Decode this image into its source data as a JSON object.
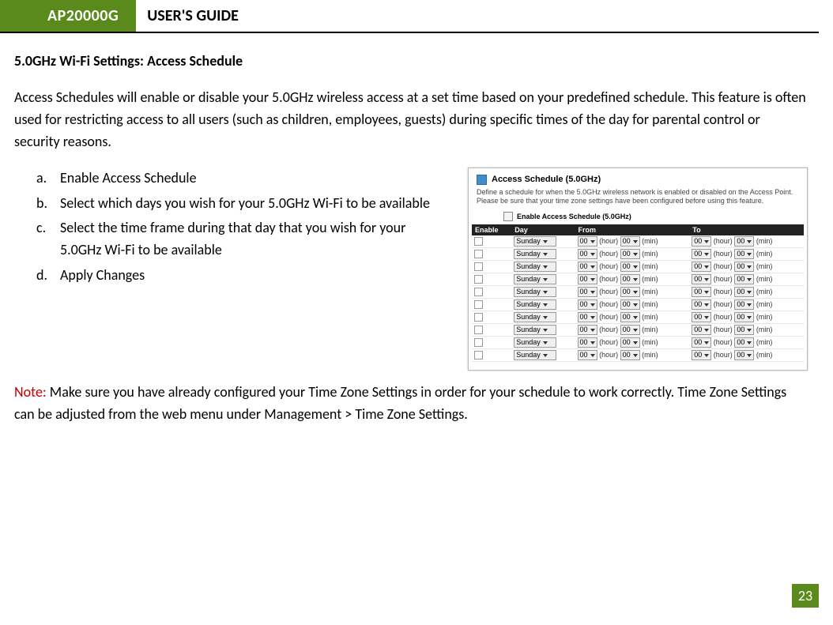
{
  "header": {
    "model": "AP20000G",
    "title": "USER'S GUIDE"
  },
  "section_title": "5.0GHz Wi-Fi Settings: Access Schedule",
  "intro": "Access Schedules will enable or disable your 5.0GHz wireless access at a set time based on your predefined schedule. This feature is often used for restricting access to all users (such as children, employees, guests) during specific times of the day for parental control or security reasons.",
  "steps": [
    {
      "marker": "a.",
      "text": "Enable Access Schedule"
    },
    {
      "marker": "b.",
      "text": "Select which days you wish for your 5.0GHz Wi-Fi to be available"
    },
    {
      "marker": "c.",
      "text": "Select the time frame during that day that you wish for your 5.0GHz Wi-Fi to be available"
    },
    {
      "marker": "d.",
      "text": "Apply Changes"
    }
  ],
  "note": {
    "label": "Note:",
    "text": " Make sure you have already configured your Time Zone Settings in order for your schedule to work correctly. Time Zone Settings can be adjusted from the web menu under Management > Time Zone Settings."
  },
  "screenshot": {
    "title": "Access Schedule (5.0GHz)",
    "desc": "Define a schedule for when the 5.0GHz wireless network is enabled or disabled on the Access Point. Please be sure that your time zone settings have been configured before using this feature.",
    "enable_label": "Enable Access Schedule (5.0GHz)",
    "columns": {
      "enable": "Enable",
      "day": "Day",
      "from": "From",
      "to": "To"
    },
    "row": {
      "day": "Sunday",
      "hour": "00",
      "min": "00",
      "hour_unit": "(hour)",
      "min_unit": "(min)"
    },
    "row_count": 10
  },
  "page_number": "23"
}
